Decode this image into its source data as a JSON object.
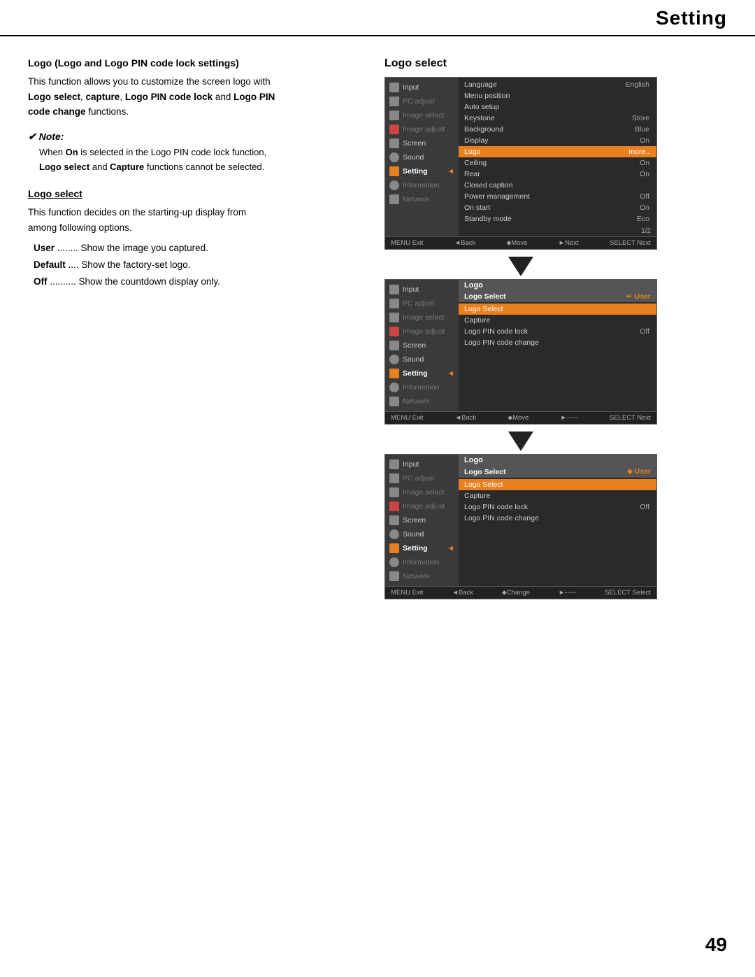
{
  "header": {
    "title": "Setting"
  },
  "left": {
    "logo_section_title": "Logo (Logo and Logo PIN code lock settings)",
    "logo_section_body": "This function allows you to customize the screen logo with",
    "logo_section_body2_parts": [
      {
        "text": "Logo select",
        "bold": true
      },
      {
        "text": ", ",
        "bold": false
      },
      {
        "text": "capture",
        "bold": true
      },
      {
        "text": ", ",
        "bold": false
      },
      {
        "text": "Logo PIN code lock",
        "bold": true
      },
      {
        "text": " and ",
        "bold": false
      },
      {
        "text": "Logo PIN",
        "bold": true
      }
    ],
    "logo_section_body3": "code change",
    "logo_section_body3_suffix": " functions.",
    "note_title": "✔ Note:",
    "note_body_prefix": "When ",
    "note_body_on": "On",
    "note_body_mid": " is selected in the Logo PIN code lock function,",
    "note_body_suffix1": "Logo select",
    "note_body_suffix2": " and ",
    "note_body_capture": "Capture",
    "note_body_end": " functions cannot be selected.",
    "logo_select_heading": "Logo select",
    "logo_select_intro": "This function decides on the starting-up display from",
    "logo_select_intro2": "among following options.",
    "options": [
      {
        "key": "User",
        "dots": "........",
        "desc": "Show the image you captured."
      },
      {
        "key": "Default",
        "dots": "....",
        "desc": "Show the factory-set logo."
      },
      {
        "key": "Off",
        "dots": "..........",
        "desc": "Show the countdown display only."
      }
    ]
  },
  "right": {
    "section_title": "Logo select",
    "screenshots": [
      {
        "id": "screen1",
        "sidebar_items": [
          {
            "label": "Input",
            "icon": "input",
            "state": "normal"
          },
          {
            "label": "PC adjust",
            "icon": "pc",
            "state": "dimmed"
          },
          {
            "label": "Image select",
            "icon": "image-sel",
            "state": "dimmed"
          },
          {
            "label": "Image adjust",
            "icon": "image-adj",
            "state": "dimmed"
          },
          {
            "label": "Screen",
            "icon": "screen",
            "state": "normal"
          },
          {
            "label": "Sound",
            "icon": "sound",
            "state": "normal"
          },
          {
            "label": "Setting",
            "icon": "setting",
            "state": "active"
          },
          {
            "label": "Information",
            "icon": "info",
            "state": "dimmed"
          },
          {
            "label": "Network",
            "icon": "network",
            "state": "dimmed"
          }
        ],
        "panel_header": "Language",
        "panel_rows": [
          {
            "label": "Language",
            "value": "English",
            "highlighted": false
          },
          {
            "label": "Menu position",
            "value": "",
            "highlighted": false
          },
          {
            "label": "Auto setup",
            "value": "",
            "highlighted": false
          },
          {
            "label": "Keystone",
            "value": "Store",
            "highlighted": false
          },
          {
            "label": "Background",
            "value": "Blue",
            "highlighted": false
          },
          {
            "label": "Display",
            "value": "On",
            "highlighted": false
          },
          {
            "label": "Logo",
            "value": "more..",
            "highlighted": true
          },
          {
            "label": "Ceiling",
            "value": "On",
            "highlighted": false
          },
          {
            "label": "Rear",
            "value": "On",
            "highlighted": false
          },
          {
            "label": "Closed caption",
            "value": "",
            "highlighted": false
          },
          {
            "label": "Power management",
            "value": "Off",
            "highlighted": false
          },
          {
            "label": "On start",
            "value": "On",
            "highlighted": false
          },
          {
            "label": "Standby mode",
            "value": "Eco",
            "highlighted": false
          }
        ],
        "page_num": "1/2",
        "bottom_bar": {
          "exit": "MENU Exit",
          "back": "◄Back",
          "move": "⬥Move",
          "next_label": "►Next",
          "select": "SELECT Next"
        }
      },
      {
        "id": "screen2",
        "sidebar_items": [
          {
            "label": "Input",
            "icon": "input",
            "state": "normal"
          },
          {
            "label": "PC adjust",
            "icon": "pc",
            "state": "dimmed"
          },
          {
            "label": "Image select",
            "icon": "image-sel",
            "state": "dimmed"
          },
          {
            "label": "Image adjust",
            "icon": "image-adj",
            "state": "dimmed"
          },
          {
            "label": "Screen",
            "icon": "screen",
            "state": "normal"
          },
          {
            "label": "Sound",
            "icon": "sound",
            "state": "normal"
          },
          {
            "label": "Setting",
            "icon": "setting",
            "state": "active"
          },
          {
            "label": "Information",
            "icon": "info",
            "state": "dimmed"
          },
          {
            "label": "Network",
            "icon": "network",
            "state": "dimmed"
          }
        ],
        "panel_header": "Logo",
        "sub_header": "Logo Select",
        "sub_val": "User",
        "sub_rows": [
          {
            "label": "Logo Select",
            "value": "User",
            "highlighted": true
          },
          {
            "label": "Capture",
            "value": "",
            "highlighted": false
          },
          {
            "label": "Logo PIN code lock",
            "value": "Off",
            "highlighted": false
          },
          {
            "label": "Logo PIN code change",
            "value": "",
            "highlighted": false
          }
        ],
        "bottom_bar": {
          "exit": "MENU Exit",
          "back": "◄Back",
          "move": "⬥Move",
          "next_label": "►-----",
          "select": "SELECT Next"
        }
      },
      {
        "id": "screen3",
        "sidebar_items": [
          {
            "label": "Input",
            "icon": "input",
            "state": "normal"
          },
          {
            "label": "PC adjust",
            "icon": "pc",
            "state": "dimmed"
          },
          {
            "label": "Image select",
            "icon": "image-sel",
            "state": "dimmed"
          },
          {
            "label": "Image adjust",
            "icon": "image-adj",
            "state": "dimmed"
          },
          {
            "label": "Screen",
            "icon": "screen",
            "state": "normal"
          },
          {
            "label": "Sound",
            "icon": "sound",
            "state": "normal"
          },
          {
            "label": "Setting",
            "icon": "setting",
            "state": "active"
          },
          {
            "label": "Information",
            "icon": "info",
            "state": "dimmed"
          },
          {
            "label": "Network",
            "icon": "network",
            "state": "dimmed"
          }
        ],
        "panel_header": "Logo",
        "sub_header": "Logo Select",
        "sub_val": "User",
        "sub_rows": [
          {
            "label": "Logo Select",
            "value": "User",
            "highlighted": true
          },
          {
            "label": "Capture",
            "value": "",
            "highlighted": false
          },
          {
            "label": "Logo PIN code lock",
            "value": "Off",
            "highlighted": false
          },
          {
            "label": "Logo PIN code change",
            "value": "",
            "highlighted": false
          }
        ],
        "bottom_bar": {
          "exit": "MENU Exit",
          "back": "◄Back",
          "move": "⬥Change",
          "next_label": "►-----",
          "select": "SELECT Select"
        }
      }
    ]
  },
  "page_number": "49"
}
